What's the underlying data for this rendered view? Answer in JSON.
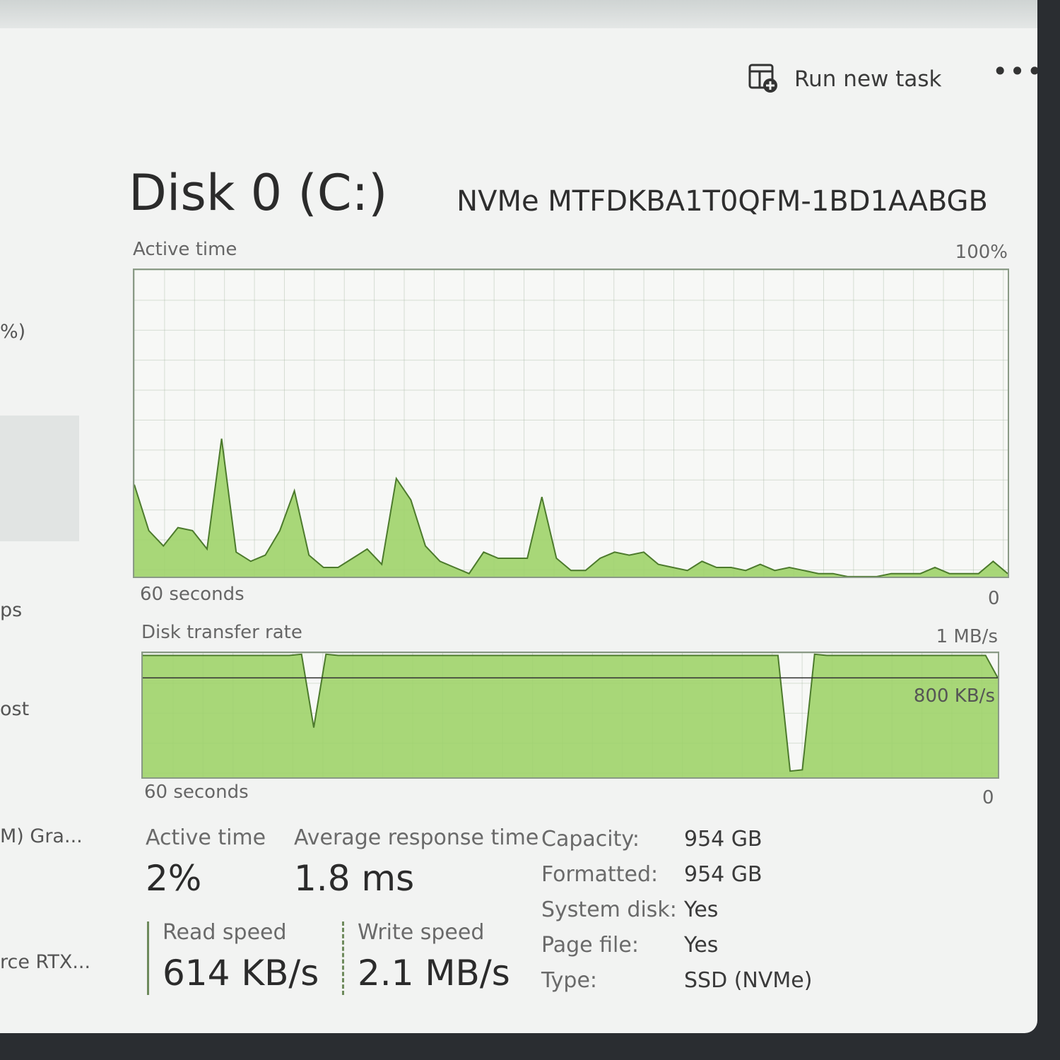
{
  "toolbar": {
    "run_new_task_label": "Run new task",
    "more_label": "•••"
  },
  "sidebar": {
    "fragments": [
      "%)",
      "ps",
      "ost",
      "M) Gra...",
      "rce RTX..."
    ]
  },
  "disk": {
    "title": "Disk 0 (C:)",
    "model": "NVMe MTFDKBA1T0QFM-1BD1AABGB"
  },
  "active_chart": {
    "label": "Active time",
    "max_label": "100%",
    "x_left_label": "60 seconds",
    "x_right_label": "0"
  },
  "transfer_chart": {
    "label": "Disk transfer rate",
    "max_label": "1 MB/s",
    "line_label": "800 KB/s",
    "x_left_label": "60 seconds",
    "x_right_label": "0"
  },
  "stats": {
    "active_time_label": "Active time",
    "active_time_value": "2%",
    "avg_response_label": "Average response time",
    "avg_response_value": "1.8 ms",
    "read_speed_label": "Read speed",
    "read_speed_value": "614 KB/s",
    "write_speed_label": "Write speed",
    "write_speed_value": "2.1 MB/s"
  },
  "properties": [
    {
      "label": "Capacity:",
      "value": "954 GB"
    },
    {
      "label": "Formatted:",
      "value": "954 GB"
    },
    {
      "label": "System disk:",
      "value": "Yes"
    },
    {
      "label": "Page file:",
      "value": "Yes"
    },
    {
      "label": "Type:",
      "value": "SSD (NVMe)"
    }
  ],
  "colors": {
    "accent_fill": "#9fd36a",
    "accent_line": "#4c7a2c"
  },
  "chart_data": [
    {
      "type": "area",
      "ylim": [
        0,
        100
      ],
      "values": [
        30,
        15,
        10,
        16,
        15,
        9,
        45,
        8,
        5,
        7,
        15,
        28,
        7,
        3,
        3,
        6,
        9,
        4,
        32,
        25,
        10,
        5,
        3,
        1,
        8,
        6,
        6,
        6,
        26,
        6,
        2,
        2,
        6,
        8,
        7,
        8,
        4,
        3,
        2,
        5,
        3,
        3,
        2,
        4,
        2,
        3,
        2,
        1,
        1,
        0,
        0,
        0,
        1,
        1,
        1,
        3,
        1,
        1,
        1,
        5,
        1
      ]
    },
    {
      "type": "area",
      "ylim": [
        0,
        1000
      ],
      "values": [
        980,
        980,
        980,
        980,
        980,
        980,
        980,
        980,
        980,
        980,
        980,
        980,
        980,
        990,
        400,
        990,
        980,
        980,
        980,
        980,
        980,
        980,
        980,
        980,
        980,
        980,
        980,
        980,
        980,
        980,
        980,
        980,
        980,
        980,
        980,
        980,
        980,
        980,
        980,
        980,
        980,
        980,
        980,
        980,
        980,
        980,
        980,
        980,
        980,
        980,
        980,
        980,
        980,
        50,
        60,
        990,
        980,
        980,
        980,
        980,
        980,
        980,
        980,
        980,
        980,
        980,
        980,
        980,
        980,
        980,
        800
      ]
    }
  ]
}
